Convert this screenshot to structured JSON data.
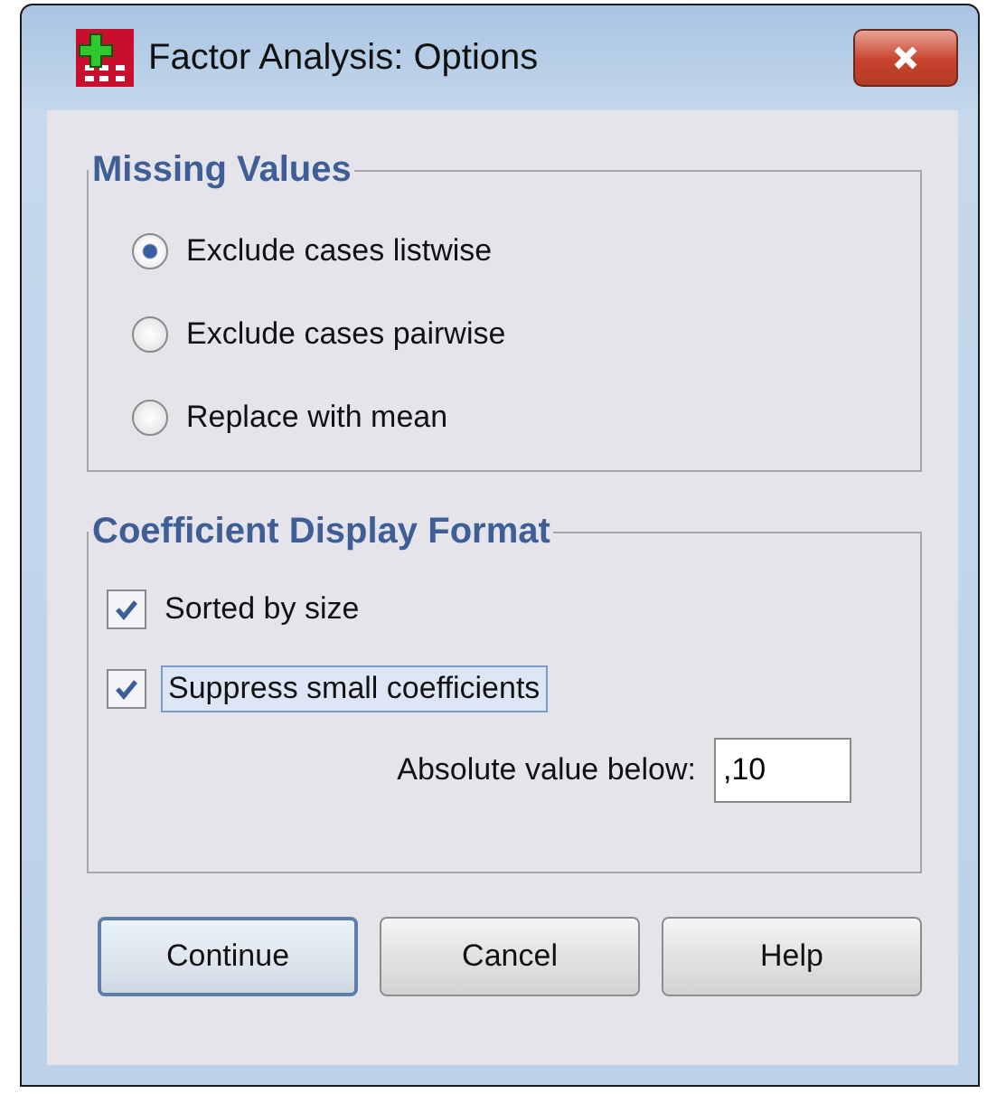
{
  "window": {
    "title": "Factor Analysis: Options"
  },
  "missing_values": {
    "title": "Missing Values",
    "options": [
      {
        "label": "Exclude cases listwise",
        "selected": true
      },
      {
        "label": "Exclude cases pairwise",
        "selected": false
      },
      {
        "label": "Replace with mean",
        "selected": false
      }
    ]
  },
  "coefficient_display": {
    "title": "Coefficient Display Format",
    "options": [
      {
        "label": "Sorted by size",
        "checked": true,
        "focused": false
      },
      {
        "label": "Suppress small coefficients",
        "checked": true,
        "focused": true
      }
    ],
    "absolute_value": {
      "label": "Absolute value below:",
      "value": ",10"
    }
  },
  "buttons": [
    {
      "label": "Continue",
      "default": true
    },
    {
      "label": "Cancel",
      "default": false
    },
    {
      "label": "Help",
      "default": false
    }
  ]
}
